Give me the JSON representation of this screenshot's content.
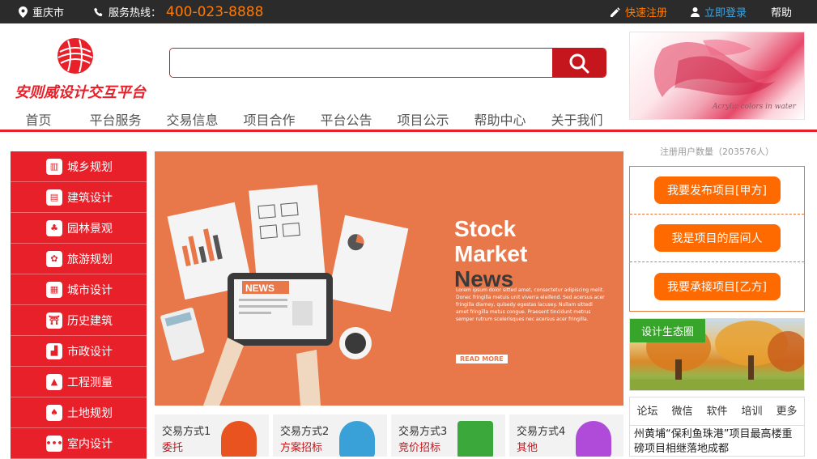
{
  "topbar": {
    "city": "重庆市",
    "hotline_label": "服务热线：",
    "hotline_number": "400-023-8888",
    "register": "快速注册",
    "login": "立即登录",
    "help": "帮助"
  },
  "logo": {
    "text": "安则威设计交互平台"
  },
  "search": {
    "placeholder": ""
  },
  "ad": {
    "caption": "Acrylic colors in water"
  },
  "nav": [
    "首页",
    "平台服务",
    "交易信息",
    "项目合作",
    "平台公告",
    "项目公示",
    "帮助中心",
    "关于我们"
  ],
  "sidebar": [
    {
      "label": "城乡规划",
      "icon": "city-icon"
    },
    {
      "label": "建筑设计",
      "icon": "building-icon"
    },
    {
      "label": "园林景观",
      "icon": "tree-icon"
    },
    {
      "label": "旅游规划",
      "icon": "travel-icon"
    },
    {
      "label": "城市设计",
      "icon": "urban-icon"
    },
    {
      "label": "历史建筑",
      "icon": "heritage-icon"
    },
    {
      "label": "市政设计",
      "icon": "factory-icon"
    },
    {
      "label": "工程测量",
      "icon": "survey-icon"
    },
    {
      "label": "土地规划",
      "icon": "land-icon"
    },
    {
      "label": "室内设计",
      "icon": "interior-icon"
    }
  ],
  "banner": {
    "headline1": "Stock",
    "headline2": "Market",
    "headline3": "News",
    "body": "Lorem ipsum dolor sitted amet, consectetur adipiscing melit. Donec fringilla metuis unit viverra eleifend. Sed acersus acer fringilla diamey, quisedy egestas lacusey. Nullam sittedl amet fringilla metus congue. Praesent tincidunt metrus semper rutrum scelerisques nec acersus acer fringilla.",
    "read_more": "READ MORE",
    "news_tag": "NEWS"
  },
  "trades": [
    {
      "title": "交易方式1",
      "type": "委托",
      "color": "#e8531f"
    },
    {
      "title": "交易方式2",
      "type": "方案招标",
      "color": "#3aa0d8"
    },
    {
      "title": "交易方式3",
      "type": "竞价招标",
      "color": "#3aa83a"
    },
    {
      "title": "交易方式4",
      "type": "其他",
      "color": "#b04ad8"
    }
  ],
  "right": {
    "user_count": "注册用户数量（203576人）",
    "buttons": [
      "我要发布项目[甲方]",
      "我是项目的居间人",
      "我要承接项目[乙方]"
    ],
    "eco_label": "设计生态圈",
    "forum_tabs": [
      "论坛",
      "微信",
      "软件",
      "培训",
      "更多"
    ],
    "news": "州黄埔“保利鱼珠港”项目最高楼重磅项目相继落地成都"
  },
  "colors": {
    "brand": "#e8202a",
    "accent": "#ff6a00",
    "dark": "#2b2b2b"
  }
}
